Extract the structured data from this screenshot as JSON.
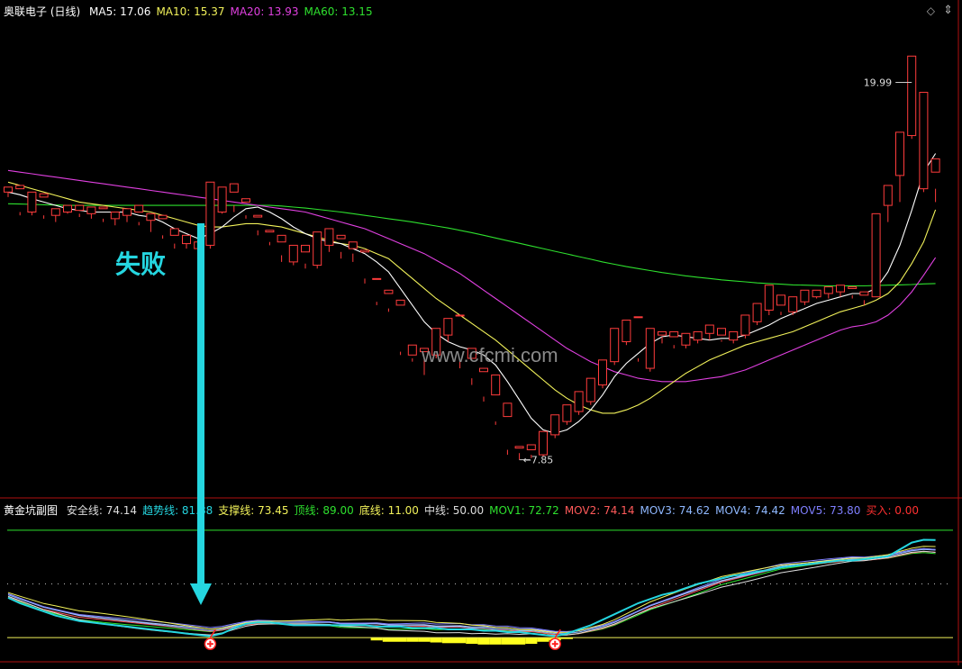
{
  "chart_data": [
    {
      "type": "candlestick",
      "title": "奥联电子 (日线)",
      "ma_labels": [
        {
          "name": "MA5",
          "value": "17.06",
          "color": "#ffffff"
        },
        {
          "name": "MA10",
          "value": "15.37",
          "color": "#f2f25a"
        },
        {
          "name": "MA20",
          "value": "13.93",
          "color": "#e040e0"
        },
        {
          "name": "MA60",
          "value": "13.15",
          "color": "#2ee02e"
        }
      ],
      "ylim": [
        7.0,
        21.0
      ],
      "candles": [
        [
          15.9,
          16.05,
          15.75,
          16.0
        ],
        [
          16.0,
          16.1,
          15.2,
          15.3
        ],
        [
          15.3,
          15.9,
          15.2,
          15.8
        ],
        [
          15.75,
          15.85,
          15.1,
          15.2
        ],
        [
          15.2,
          15.4,
          15.0,
          15.35
        ],
        [
          15.3,
          15.5,
          15.25,
          15.35
        ],
        [
          15.35,
          15.5,
          15.15,
          15.25
        ],
        [
          15.25,
          15.45,
          15.1,
          15.35
        ],
        [
          15.4,
          15.45,
          15.0,
          15.1
        ],
        [
          15.1,
          15.3,
          14.9,
          15.2
        ],
        [
          15.2,
          15.4,
          15.0,
          15.3
        ],
        [
          15.3,
          15.5,
          14.9,
          15.0
        ],
        [
          15.05,
          15.25,
          14.7,
          15.1
        ],
        [
          15.1,
          15.2,
          14.5,
          14.6
        ],
        [
          14.6,
          14.8,
          14.2,
          14.35
        ],
        [
          14.35,
          14.6,
          14.2,
          14.5
        ],
        [
          14.2,
          14.4,
          14.1,
          14.3
        ],
        [
          14.3,
          16.2,
          14.2,
          15.9
        ],
        [
          15.3,
          16.05,
          15.25,
          15.75
        ],
        [
          15.9,
          16.15,
          15.3,
          15.5
        ],
        [
          15.6,
          15.7,
          15.1,
          15.2
        ],
        [
          15.15,
          15.2,
          14.6,
          14.75
        ],
        [
          14.7,
          14.75,
          14.3,
          14.4
        ],
        [
          14.4,
          14.6,
          13.8,
          14.0
        ],
        [
          13.8,
          14.3,
          13.7,
          14.1
        ],
        [
          14.1,
          14.3,
          13.6,
          13.75
        ],
        [
          13.7,
          14.7,
          13.6,
          14.2
        ],
        [
          14.3,
          14.8,
          14.1,
          14.35
        ],
        [
          14.5,
          14.6,
          13.9,
          14.1
        ],
        [
          14.2,
          14.4,
          13.8,
          14.05
        ],
        [
          14.1,
          14.15,
          13.15,
          13.3
        ],
        [
          13.3,
          13.3,
          12.5,
          12.6
        ],
        [
          12.85,
          12.95,
          12.3,
          12.4
        ],
        [
          12.5,
          12.65,
          11.0,
          11.1
        ],
        [
          11.0,
          11.3,
          10.8,
          10.9
        ],
        [
          11.1,
          11.2,
          10.4,
          10.9
        ],
        [
          11.0,
          11.8,
          10.9,
          11.5
        ],
        [
          11.6,
          12.1,
          11.4,
          11.8
        ],
        [
          12.2,
          12.2,
          10.6,
          10.8
        ],
        [
          10.9,
          11.2,
          10.1,
          10.3
        ],
        [
          10.5,
          10.6,
          9.6,
          9.75
        ],
        [
          9.8,
          10.4,
          8.9,
          9.0
        ],
        [
          9.15,
          9.55,
          8.0,
          8.15
        ],
        [
          8.2,
          8.25,
          7.85,
          8.05
        ],
        [
          8.15,
          8.3,
          7.9,
          8.0
        ],
        [
          8.0,
          8.7,
          7.95,
          8.5
        ],
        [
          8.6,
          9.2,
          8.5,
          9.0
        ],
        [
          9.0,
          9.5,
          8.9,
          9.4
        ],
        [
          9.3,
          9.9,
          9.2,
          9.6
        ],
        [
          9.6,
          10.3,
          9.5,
          10.1
        ],
        [
          10.1,
          10.85,
          10.0,
          10.7
        ],
        [
          10.8,
          11.8,
          10.7,
          11.5
        ],
        [
          11.4,
          12.05,
          11.3,
          11.8
        ],
        [
          12.15,
          12.15,
          10.8,
          10.9
        ],
        [
          10.6,
          11.8,
          10.5,
          11.6
        ],
        [
          11.6,
          11.7,
          11.35,
          11.55
        ],
        [
          11.55,
          11.7,
          11.2,
          11.3
        ],
        [
          11.3,
          11.65,
          11.2,
          11.45
        ],
        [
          11.45,
          11.7,
          11.35,
          11.6
        ],
        [
          11.65,
          11.9,
          11.45,
          11.8
        ],
        [
          11.6,
          11.8,
          11.4,
          11.45
        ],
        [
          11.45,
          11.7,
          11.35,
          11.55
        ],
        [
          11.6,
          12.2,
          11.5,
          12.15
        ],
        [
          12.0,
          12.55,
          11.9,
          12.45
        ],
        [
          12.35,
          13.1,
          12.2,
          12.55
        ],
        [
          12.5,
          12.8,
          12.2,
          12.3
        ],
        [
          12.3,
          12.75,
          12.2,
          12.65
        ],
        [
          12.6,
          12.95,
          12.5,
          12.85
        ],
        [
          12.75,
          12.95,
          12.7,
          12.85
        ],
        [
          12.85,
          13.05,
          12.7,
          12.95
        ],
        [
          12.9,
          13.1,
          12.75,
          13.0
        ],
        [
          13.0,
          13.05,
          12.7,
          12.8
        ],
        [
          12.8,
          12.9,
          12.5,
          12.65
        ],
        [
          12.75,
          15.25,
          12.75,
          15.1
        ],
        [
          15.5,
          16.1,
          15.0,
          15.9
        ],
        [
          16.4,
          17.7,
          15.6,
          17.5
        ],
        [
          17.6,
          19.99,
          17.5,
          19.2
        ],
        [
          16.0,
          18.9,
          15.9,
          17.3
        ],
        [
          16.5,
          16.9,
          15.6,
          16.0
        ]
      ],
      "annotations": [
        {
          "label": "19.99",
          "at": "high",
          "index": 76
        },
        {
          "label": "7.85",
          "at": "low",
          "index": 43
        }
      ],
      "ma5": [
        15.9,
        15.82,
        15.7,
        15.6,
        15.5,
        15.4,
        15.35,
        15.3,
        15.3,
        15.3,
        15.3,
        15.2,
        15.15,
        15.0,
        14.8,
        14.65,
        14.5,
        14.65,
        14.85,
        15.15,
        15.4,
        15.45,
        15.3,
        15.1,
        14.85,
        14.65,
        14.5,
        14.4,
        14.35,
        14.2,
        14.05,
        13.8,
        13.5,
        13.0,
        12.5,
        12.0,
        11.65,
        11.4,
        11.25,
        11.15,
        11.0,
        10.7,
        10.2,
        9.65,
        9.1,
        8.75,
        8.65,
        8.75,
        9.0,
        9.35,
        9.8,
        10.35,
        10.75,
        11.05,
        11.35,
        11.55,
        11.6,
        11.55,
        11.5,
        11.45,
        11.5,
        11.5,
        11.6,
        11.75,
        11.9,
        12.1,
        12.25,
        12.4,
        12.55,
        12.65,
        12.75,
        12.85,
        12.85,
        13.0,
        13.5,
        14.3,
        15.35,
        16.5,
        17.06
      ],
      "ma10": [
        16.2,
        16.1,
        16.0,
        15.9,
        15.8,
        15.7,
        15.6,
        15.55,
        15.5,
        15.45,
        15.4,
        15.35,
        15.3,
        15.2,
        15.1,
        15.0,
        14.9,
        14.85,
        14.85,
        14.9,
        14.95,
        14.95,
        14.9,
        14.85,
        14.75,
        14.65,
        14.55,
        14.45,
        14.35,
        14.3,
        14.2,
        14.05,
        13.9,
        13.6,
        13.3,
        13.0,
        12.7,
        12.45,
        12.2,
        11.95,
        11.7,
        11.45,
        11.15,
        10.85,
        10.55,
        10.25,
        9.95,
        9.7,
        9.5,
        9.35,
        9.25,
        9.25,
        9.35,
        9.5,
        9.7,
        9.95,
        10.2,
        10.45,
        10.65,
        10.85,
        11.0,
        11.15,
        11.3,
        11.4,
        11.5,
        11.6,
        11.7,
        11.85,
        12.0,
        12.15,
        12.3,
        12.4,
        12.5,
        12.65,
        12.85,
        13.2,
        13.75,
        14.4,
        15.37
      ],
      "ma20": [
        16.55,
        16.5,
        16.45,
        16.4,
        16.35,
        16.3,
        16.25,
        16.2,
        16.15,
        16.1,
        16.05,
        16.0,
        15.95,
        15.9,
        15.85,
        15.8,
        15.75,
        15.7,
        15.65,
        15.6,
        15.55,
        15.5,
        15.45,
        15.4,
        15.35,
        15.3,
        15.2,
        15.1,
        15.0,
        14.9,
        14.8,
        14.65,
        14.5,
        14.35,
        14.2,
        14.05,
        13.85,
        13.65,
        13.45,
        13.2,
        12.95,
        12.7,
        12.45,
        12.2,
        11.95,
        11.7,
        11.45,
        11.2,
        11.0,
        10.8,
        10.65,
        10.5,
        10.4,
        10.3,
        10.25,
        10.2,
        10.2,
        10.2,
        10.25,
        10.3,
        10.35,
        10.45,
        10.55,
        10.7,
        10.85,
        11.0,
        11.15,
        11.3,
        11.45,
        11.6,
        11.75,
        11.85,
        11.9,
        12.0,
        12.2,
        12.5,
        12.9,
        13.4,
        13.93
      ],
      "ma60": [
        15.55,
        15.54,
        15.53,
        15.52,
        15.51,
        15.5,
        15.5,
        15.5,
        15.5,
        15.5,
        15.5,
        15.5,
        15.5,
        15.5,
        15.5,
        15.5,
        15.5,
        15.5,
        15.5,
        15.5,
        15.5,
        15.5,
        15.5,
        15.48,
        15.45,
        15.42,
        15.38,
        15.34,
        15.3,
        15.25,
        15.2,
        15.15,
        15.1,
        15.05,
        15.0,
        14.94,
        14.88,
        14.82,
        14.75,
        14.68,
        14.6,
        14.52,
        14.44,
        14.36,
        14.28,
        14.2,
        14.12,
        14.04,
        13.96,
        13.88,
        13.8,
        13.73,
        13.66,
        13.6,
        13.54,
        13.48,
        13.43,
        13.38,
        13.34,
        13.3,
        13.26,
        13.23,
        13.2,
        13.17,
        13.15,
        13.13,
        13.11,
        13.1,
        13.09,
        13.08,
        13.08,
        13.08,
        13.08,
        13.09,
        13.1,
        13.11,
        13.12,
        13.14,
        13.15
      ]
    },
    {
      "type": "line",
      "title": "黄金坑副图",
      "values": [
        {
          "name": "安全线",
          "value": "74.14",
          "color": "#dddddd"
        },
        {
          "name": "趋势线",
          "value": "81.88",
          "color": "#25d6e0"
        },
        {
          "name": "支撑线",
          "value": "73.45",
          "color": "#f2f25a"
        },
        {
          "name": "顶线",
          "value": "89.00",
          "color": "#2ee02e"
        },
        {
          "name": "底线",
          "value": "11.00",
          "color": "#f2f25a"
        },
        {
          "name": "中线",
          "value": "50.00",
          "color": "#dddddd"
        },
        {
          "name": "MOV1",
          "value": "72.72",
          "color": "#2ee02e"
        },
        {
          "name": "MOV2",
          "value": "74.14",
          "color": "#ff5a5a"
        },
        {
          "name": "MOV3",
          "value": "74.62",
          "color": "#8fb8ff"
        },
        {
          "name": "MOV4",
          "value": "74.42",
          "color": "#8fb8ff"
        },
        {
          "name": "MOV5",
          "value": "73.80",
          "color": "#7f7fff"
        },
        {
          "name": "买入",
          "value": "0.00",
          "color": "#ff3030"
        }
      ],
      "ylim": [
        0,
        100
      ],
      "top_line": 89,
      "bottom_line": 11,
      "mid_line": 50,
      "trend": [
        40,
        36,
        33,
        30,
        27,
        25,
        23,
        22,
        21,
        20,
        19,
        18,
        17,
        16,
        15,
        14,
        13,
        12,
        14,
        18,
        21,
        22,
        22,
        21,
        20,
        20,
        20,
        20,
        20,
        20,
        20,
        19,
        19,
        19,
        18,
        18,
        18,
        17,
        17,
        17,
        16,
        16,
        15,
        15,
        14,
        13,
        12,
        14,
        17,
        20,
        24,
        28,
        32,
        36,
        39,
        42,
        44,
        47,
        50,
        52,
        54,
        56,
        57,
        59,
        60,
        62,
        63,
        64,
        65,
        66,
        67,
        67,
        68,
        69,
        70,
        75,
        80,
        82,
        81.88
      ],
      "mov_base": [
        42,
        39,
        36,
        33,
        31,
        29,
        27,
        26,
        25,
        24,
        23,
        22,
        21,
        20,
        19,
        18,
        17,
        16,
        17,
        19,
        21,
        22,
        22,
        22,
        22,
        22,
        22,
        22,
        21,
        21,
        21,
        21,
        20,
        20,
        20,
        20,
        19,
        19,
        19,
        18,
        18,
        17,
        17,
        16,
        16,
        15,
        14,
        14,
        15,
        17,
        19,
        22,
        26,
        30,
        34,
        37,
        40,
        43,
        46,
        49,
        52,
        54,
        56,
        58,
        60,
        62,
        63,
        64,
        65,
        66,
        67,
        68,
        68,
        69,
        70,
        72,
        74,
        75,
        74.5
      ],
      "yellow_fill": [
        0,
        0,
        0,
        0,
        0,
        0,
        0,
        0,
        0,
        0,
        0,
        0,
        0,
        0,
        0,
        0,
        0,
        0,
        0,
        0,
        0,
        0,
        0,
        0,
        0,
        0,
        0,
        0,
        0,
        0,
        0,
        2,
        3,
        3,
        3,
        3,
        3.5,
        4,
        4,
        4.5,
        5,
        5,
        5,
        5,
        4.5,
        3,
        2,
        1,
        0,
        0,
        0,
        0,
        0,
        0,
        0,
        0,
        0,
        0,
        0,
        0,
        0,
        0,
        0,
        0,
        0,
        0,
        0,
        0,
        0,
        0,
        0,
        0,
        0,
        0,
        0,
        0,
        0,
        0,
        0
      ],
      "buy_markers": [
        17,
        46
      ],
      "callout": {
        "text": "失败",
        "color": "#25d6e0"
      }
    }
  ],
  "watermark": "www.cfcmi.com"
}
